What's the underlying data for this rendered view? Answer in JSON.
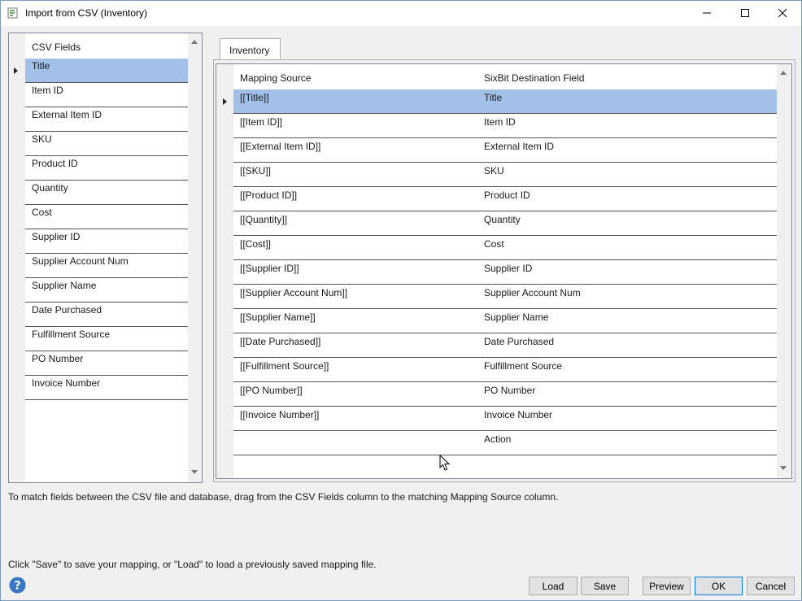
{
  "window": {
    "title": "Import from CSV (Inventory)"
  },
  "csv_fields": {
    "header": "CSV Fields",
    "items": [
      "Title",
      "Item ID",
      "External Item ID",
      "SKU",
      "Product ID",
      "Quantity",
      "Cost",
      "Supplier ID",
      "Supplier Account Num",
      "Supplier Name",
      "Date Purchased",
      "Fulfillment Source",
      "PO Number",
      "Invoice Number"
    ],
    "selected_index": 0
  },
  "tabs": [
    {
      "label": "Inventory",
      "active": true
    }
  ],
  "mapping": {
    "col_source": "Mapping Source",
    "col_destination": "SixBit Destination Field",
    "selected_index": 0,
    "rows": [
      {
        "source": "[[Title]]",
        "destination": "Title"
      },
      {
        "source": "[[Item ID]]",
        "destination": "Item ID"
      },
      {
        "source": "[[External Item ID]]",
        "destination": "External Item ID"
      },
      {
        "source": "[[SKU]]",
        "destination": "SKU"
      },
      {
        "source": "[[Product ID]]",
        "destination": "Product ID"
      },
      {
        "source": "[[Quantity]]",
        "destination": "Quantity"
      },
      {
        "source": "[[Cost]]",
        "destination": "Cost"
      },
      {
        "source": "[[Supplier ID]]",
        "destination": "Supplier ID"
      },
      {
        "source": "[[Supplier Account Num]]",
        "destination": "Supplier Account Num"
      },
      {
        "source": "[[Supplier Name]]",
        "destination": "Supplier Name"
      },
      {
        "source": "[[Date Purchased]]",
        "destination": "Date Purchased"
      },
      {
        "source": "[[Fulfillment Source]]",
        "destination": "Fulfillment Source"
      },
      {
        "source": "[[PO Number]]",
        "destination": "PO Number"
      },
      {
        "source": "[[Invoice Number]]",
        "destination": "Invoice Number"
      },
      {
        "source": "",
        "destination": "Action"
      },
      {
        "source": "",
        "destination": ""
      }
    ]
  },
  "hints": {
    "drag": "To match fields between the CSV file and database, drag from the CSV Fields column to the matching Mapping Source column.",
    "save_load": "Click \"Save\" to save your mapping, or \"Load\" to load a previously saved mapping file."
  },
  "buttons": {
    "load": "Load",
    "save": "Save",
    "preview": "Preview",
    "ok": "OK",
    "cancel": "Cancel"
  },
  "colors": {
    "selection": "#a3c0e8",
    "accent": "#0078d7",
    "help_icon": "#3a78c4"
  }
}
